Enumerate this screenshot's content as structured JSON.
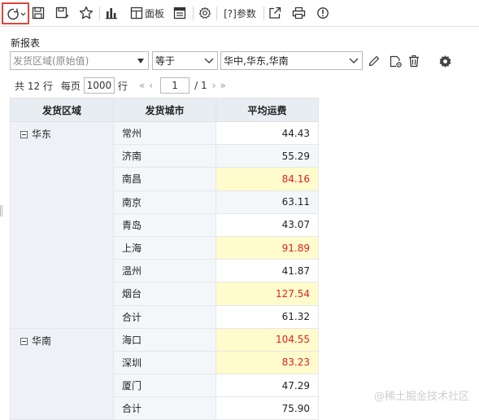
{
  "toolbar": {
    "refresh_icon": "refresh-icon",
    "panel_label": "面板",
    "params_label": "[?]参数"
  },
  "report": {
    "title": "新报表"
  },
  "filter": {
    "field_placeholder": "发货区域(原始值)",
    "operator": "等于",
    "value": "华中,华东,华南"
  },
  "pager": {
    "total_label": "共 12 行",
    "per_page_label": "每页",
    "per_page": "1000",
    "row_unit": "行",
    "current_page": "1",
    "page_total": "/ 1"
  },
  "table": {
    "headers": [
      "发货区域",
      "发货城市",
      "平均运费"
    ],
    "groups": [
      {
        "region": "华东",
        "rows": [
          {
            "city": "常州",
            "fee": "44.43",
            "highlight": false
          },
          {
            "city": "济南",
            "fee": "55.29",
            "highlight": false
          },
          {
            "city": "南昌",
            "fee": "84.16",
            "highlight": true
          },
          {
            "city": "南京",
            "fee": "63.11",
            "highlight": false
          },
          {
            "city": "青岛",
            "fee": "43.07",
            "highlight": false
          },
          {
            "city": "上海",
            "fee": "91.89",
            "highlight": true
          },
          {
            "city": "温州",
            "fee": "41.87",
            "highlight": false
          },
          {
            "city": "烟台",
            "fee": "127.54",
            "highlight": true
          },
          {
            "city": "合计",
            "fee": "61.32",
            "highlight": false
          }
        ]
      },
      {
        "region": "华南",
        "rows": [
          {
            "city": "海口",
            "fee": "104.55",
            "highlight": true
          },
          {
            "city": "深圳",
            "fee": "83.23",
            "highlight": true
          },
          {
            "city": "厦门",
            "fee": "47.29",
            "highlight": false
          },
          {
            "city": "合计",
            "fee": "75.90",
            "highlight": false
          }
        ]
      }
    ]
  },
  "watermark": "@稀土掘金技术社区",
  "colors": {
    "highlight_bg": "#fffbcc",
    "highlight_text": "#e02020",
    "refresh_border": "#e0443c",
    "header_bg": "#e8edf2"
  }
}
